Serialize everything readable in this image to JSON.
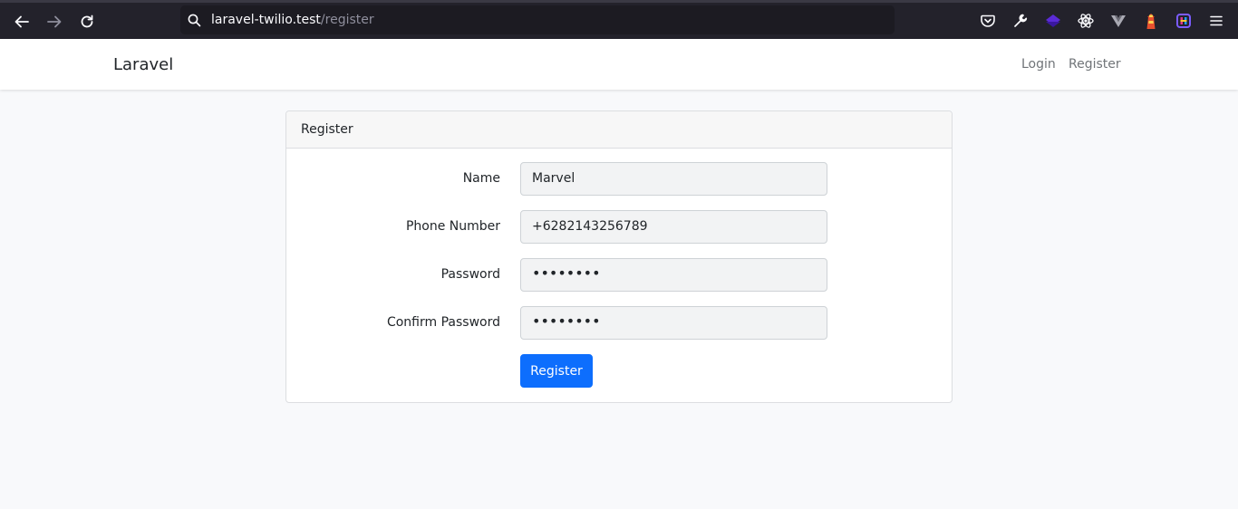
{
  "browser": {
    "url_host": "laravel-twilio.test",
    "url_path": "/register"
  },
  "navbar": {
    "brand": "Laravel",
    "links": [
      {
        "label": "Login"
      },
      {
        "label": "Register"
      }
    ]
  },
  "card": {
    "title": "Register",
    "fields": [
      {
        "label": "Name",
        "value": "Marvel"
      },
      {
        "label": "Phone Number",
        "value": "+6282143256789"
      },
      {
        "label": "Password",
        "value": "••••••••"
      },
      {
        "label": "Confirm Password",
        "value": "••••••••"
      }
    ],
    "submit_label": "Register"
  },
  "colors": {
    "primary": "#0d6efd",
    "chrome_bg": "#23222b",
    "page_bg": "#f8f9fb"
  }
}
